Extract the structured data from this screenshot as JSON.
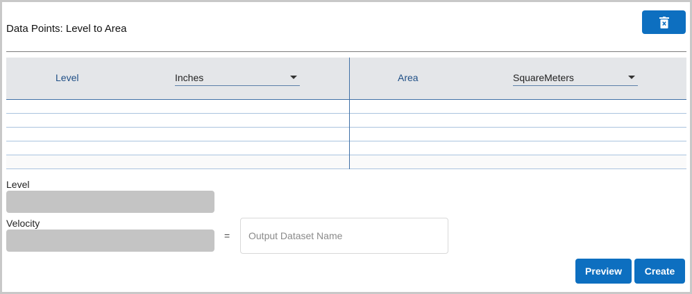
{
  "header": {
    "title": "Data Points: Level to Area",
    "delete_icon": "trash-icon"
  },
  "table": {
    "left": {
      "label": "Level",
      "unit": "Inches"
    },
    "right": {
      "label": "Area",
      "unit": "SquareMeters"
    },
    "row_count": 5
  },
  "fields": {
    "level_label": "Level",
    "velocity_label": "Velocity",
    "equals": "=",
    "output_placeholder": "Output Dataset Name"
  },
  "actions": {
    "preview_label": "Preview",
    "create_label": "Create"
  },
  "colors": {
    "accent": "#0d6fc0",
    "header_bg": "#e4e6e9",
    "disabled_input": "#c4c4c4"
  }
}
